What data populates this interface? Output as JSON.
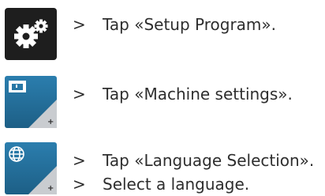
{
  "steps": [
    {
      "icon": "setup-program-gears-icon",
      "instructions": [
        {
          "marker": ">",
          "text": "Tap «Setup Program»."
        }
      ]
    },
    {
      "icon": "machine-settings-icon",
      "instructions": [
        {
          "marker": ">",
          "text": "Tap «Machine settings»."
        }
      ]
    },
    {
      "icon": "language-selection-globe-icon",
      "instructions": [
        {
          "marker": ">",
          "text": "Tap «Language Selection»."
        },
        {
          "marker": ">",
          "text": "Select a language."
        }
      ]
    }
  ],
  "colors": {
    "setup_tile": "#1e1e1e",
    "settings_tile": "#1d5f86",
    "settings_tile_light": "#2b7eae",
    "corner_tab": "#c9ccd0",
    "text": "#2e2e2e"
  }
}
